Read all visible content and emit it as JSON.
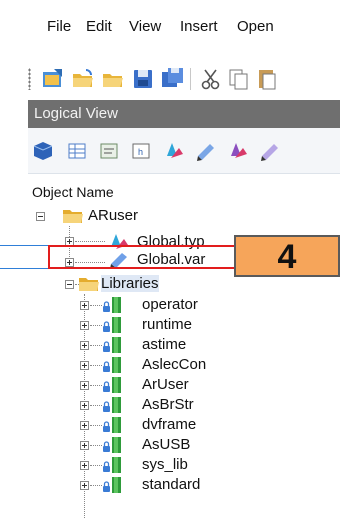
{
  "menu": [
    "File",
    "Edit",
    "View",
    "Insert",
    "Open"
  ],
  "toolbar_icons": [
    "open-folder-icon",
    "open-icon",
    "open-project-icon",
    "save-icon",
    "save-all-icon",
    "cut-icon",
    "copy-icon",
    "paste-icon"
  ],
  "panel": {
    "title": "Logical View",
    "column_header": "Object Name",
    "toolbar_icons": [
      "package-icon",
      "table-icon",
      "text-icon",
      "header-icon",
      "variable-type-icon",
      "variable-icon",
      "library-icon",
      "edit-icon"
    ]
  },
  "tree": {
    "root": "ARuser",
    "children": [
      "Global.typ",
      "Global.var",
      "Libraries"
    ],
    "libraries": [
      "operator",
      "runtime",
      "astime",
      "AslecCon",
      "ArUser",
      "AsBrStr",
      "dvframe",
      "AsUSB",
      "sys_lib",
      "standard"
    ]
  },
  "callout": {
    "number": "4"
  },
  "colors": {
    "highlight": "#e21d1d",
    "callout_bg": "#f6a55a",
    "title_bar": "#6f6f6f"
  }
}
